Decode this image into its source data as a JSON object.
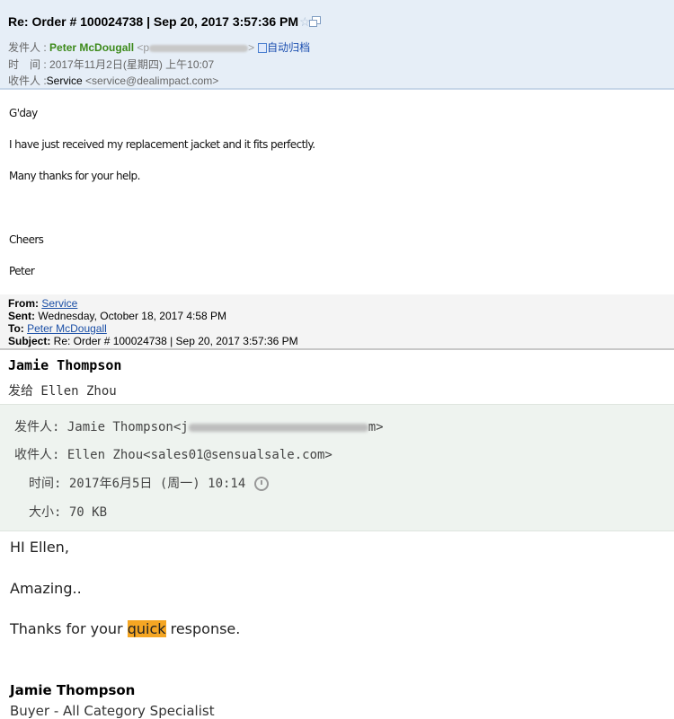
{
  "email1": {
    "subject": "Re: Order # 100024738 | Sep 20, 2017 3:57:36 PM",
    "from_label": "发件人 : ",
    "from_name": "Peter McDougall",
    "from_email_start": " <p",
    "from_email_end": ">",
    "archive_label": "自动归档",
    "time_label": "时　间 : ",
    "time_value": "2017年11月2日(星期四) 上午10:07",
    "to_label": "收件人 :",
    "to_name": "Service",
    "to_email": " <service@dealimpact.com>",
    "body": [
      "G'day",
      "I have just received my replacement jacket and it fits perfectly.",
      "Many thanks for your help.",
      "Cheers",
      "Peter"
    ],
    "quote": {
      "from_label": "From:",
      "from_value": "Service",
      "sent_label": "Sent:",
      "sent_value": " Wednesday, October 18, 2017 4:58 PM",
      "to_label": "To:",
      "to_value": "Peter McDougall",
      "subject_label": "Subject:",
      "subject_value": " Re: Order # 100024738 | Sep 20, 2017 3:57:36 PM"
    }
  },
  "email2": {
    "sender": "Jamie Thompson",
    "send_to": "发给 Ellen Zhou",
    "from_label": "发件人: ",
    "from_name": "Jamie Thompson<j",
    "from_email_end": "m>",
    "to_label": "收件人: ",
    "to_value": "Ellen Zhou<sales01@sensualsale.com>",
    "time_label": "时间: ",
    "time_value": "2017年6月5日 (周一) 10:14",
    "size_label": "大小: ",
    "size_value": "70 KB",
    "body": {
      "greeting": "HI Ellen,",
      "line1": "Amazing..",
      "line2_pre": "Thanks for your ",
      "line2_hl": "quick",
      "line2_post": " response."
    },
    "signature_name": "Jamie Thompson",
    "signature_title": "Buyer - All Category Specialist"
  },
  "colors": {
    "header_bg": "#e6eef7",
    "sender_green": "#3d8a1b",
    "link_blue": "#1b4fa6",
    "highlight": "#f5a623",
    "info_bg": "#eef3ef"
  }
}
